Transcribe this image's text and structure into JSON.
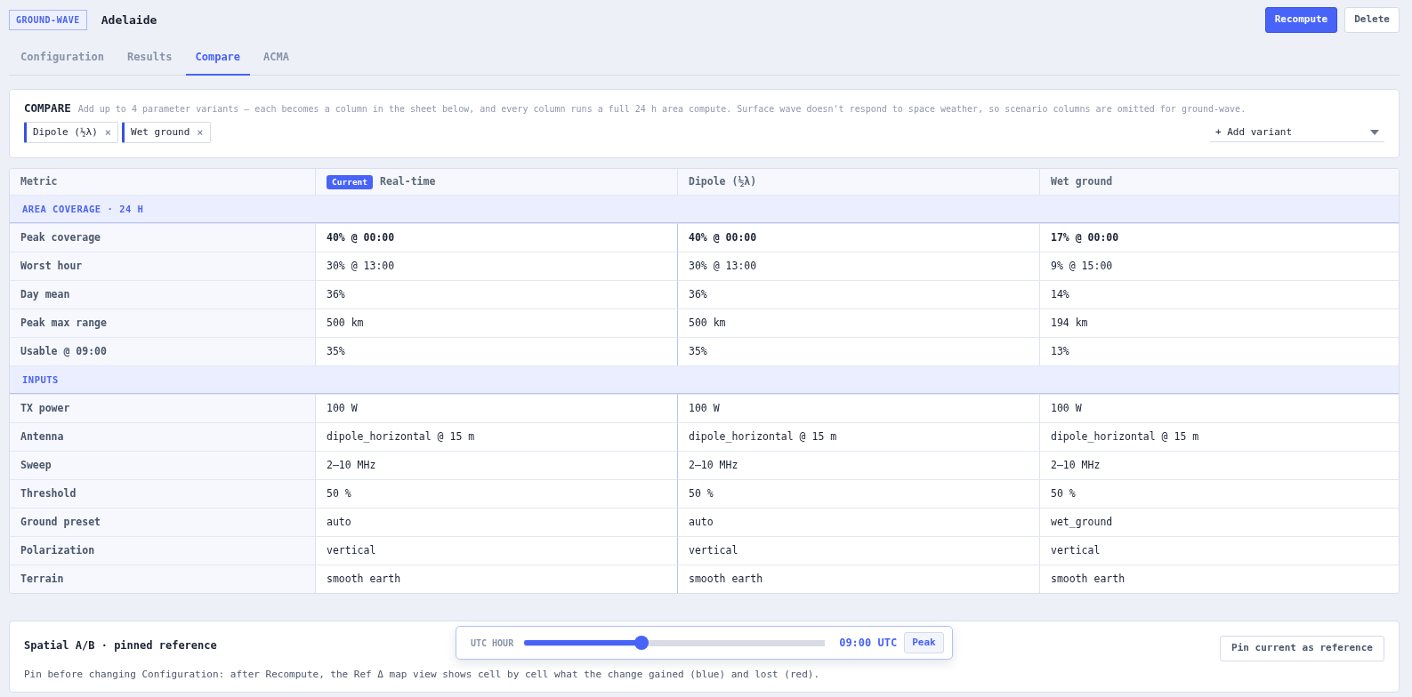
{
  "header": {
    "mode_badge": "GROUND-WAVE",
    "title": "Adelaide",
    "buttons": [
      {
        "label": "Recompute",
        "kind": "primary"
      },
      {
        "label": "Delete",
        "kind": "secondary"
      }
    ]
  },
  "tabs": [
    {
      "label": "Configuration",
      "selected": false
    },
    {
      "label": "Results",
      "selected": false
    },
    {
      "label": "Compare",
      "selected": true
    },
    {
      "label": "ACMA",
      "selected": false
    }
  ],
  "compare": {
    "title": "COMPARE",
    "description": "Add up to 4 parameter variants — each becomes a column in the sheet below, and every column runs a full 24 h area compute. Surface wave doesn't respond to space weather, so scenario columns are omitted for ground-wave.",
    "variants": [
      {
        "label": "Dipole (½λ)",
        "remove": "×"
      },
      {
        "label": "Wet ground",
        "remove": "×"
      }
    ],
    "add_select": "+ Add variant"
  },
  "table": {
    "columns": [
      {
        "label": "Metric"
      },
      {
        "label": "Real-time",
        "badge": "Current"
      },
      {
        "label": "Dipole (½λ)"
      },
      {
        "label": "Wet ground"
      }
    ],
    "sections": [
      {
        "title": "AREA COVERAGE · 24 H",
        "rows": [
          {
            "metric": "Peak coverage",
            "bold": true,
            "values": [
              "40% @ 00:00",
              "40% @ 00:00",
              "17% @ 00:00"
            ]
          },
          {
            "metric": "Worst hour",
            "bold": false,
            "values": [
              "30% @ 13:00",
              "30% @ 13:00",
              "9% @ 15:00"
            ]
          },
          {
            "metric": "Day mean",
            "bold": false,
            "values": [
              "36%",
              "36%",
              "14%"
            ]
          },
          {
            "metric": "Peak max range",
            "bold": false,
            "values": [
              "500 km",
              "500 km",
              "194 km"
            ]
          },
          {
            "metric": "Usable @ 09:00",
            "bold": false,
            "values": [
              "35%",
              "35%",
              "13%"
            ]
          }
        ]
      },
      {
        "title": "INPUTS",
        "rows": [
          {
            "metric": "TX power",
            "bold": false,
            "values": [
              "100 W",
              "100 W",
              "100 W"
            ]
          },
          {
            "metric": "Antenna",
            "bold": false,
            "values": [
              "dipole_horizontal @ 15 m",
              "dipole_horizontal @ 15 m",
              "dipole_horizontal @ 15 m"
            ]
          },
          {
            "metric": "Sweep",
            "bold": false,
            "values": [
              "2–10 MHz",
              "2–10 MHz",
              "2–10 MHz"
            ]
          },
          {
            "metric": "Threshold",
            "bold": false,
            "values": [
              "50 %",
              "50 %",
              "50 %"
            ]
          },
          {
            "metric": "Ground preset",
            "bold": false,
            "values": [
              "auto",
              "auto",
              "wet_ground"
            ]
          },
          {
            "metric": "Polarization",
            "bold": false,
            "values": [
              "vertical",
              "vertical",
              "vertical"
            ]
          },
          {
            "metric": "Terrain",
            "bold": false,
            "values": [
              "smooth earth",
              "smooth earth",
              "smooth earth"
            ]
          }
        ]
      }
    ]
  },
  "spatial": {
    "title": "Spatial A/B · pinned reference",
    "description": "Pin before changing Configuration: after Recompute, the Ref Δ map view shows cell by cell what the change gained (blue) and lost (red).",
    "pin_button": "Pin current as reference"
  },
  "utc_slider": {
    "label": "UTC HOUR",
    "level": 0.39,
    "reading": "09:00 UTC",
    "button": "Peak"
  }
}
